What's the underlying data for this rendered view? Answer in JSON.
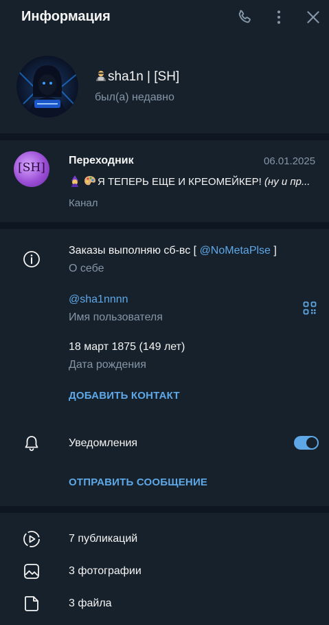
{
  "header": {
    "title": "Информация"
  },
  "profile": {
    "name": "sha1n | [SH]",
    "status": "был(а) недавно",
    "name_emoji_icon": "hacker-emoji-icon"
  },
  "channel": {
    "title": "Переходник",
    "date": "06.01.2025",
    "preview_text": "Я ТЕПЕРЬ ЕЩЕ И КРЕОМЕЙКЕР!",
    "preview_italic": "(ну и пр...",
    "type": "Канал",
    "avatar_text": "[SH]",
    "accent": "#9c4fd6"
  },
  "info": {
    "about_prefix": "Заказы выполняю сб-вс [",
    "about_link": "@NoMetaPlse",
    "about_suffix": "]",
    "about_label": "О себе",
    "username": "@sha1nnnn",
    "username_label": "Имя пользователя",
    "birthday": "18 март 1875 (149 лет)",
    "birthday_label": "Дата рождения",
    "add_contact": "ДОБАВИТЬ КОНТАКТ"
  },
  "notifications": {
    "label": "Уведомления",
    "enabled": true,
    "send_message": "ОТПРАВИТЬ СООБЩЕНИЕ"
  },
  "media": {
    "posts": "7 публикаций",
    "photos": "3 фотографии",
    "files": "3 файла"
  },
  "colors": {
    "background": "#17212b",
    "separator": "#0e1621",
    "accent_blue": "#5ea8e8",
    "secondary_text": "#8596a7"
  }
}
